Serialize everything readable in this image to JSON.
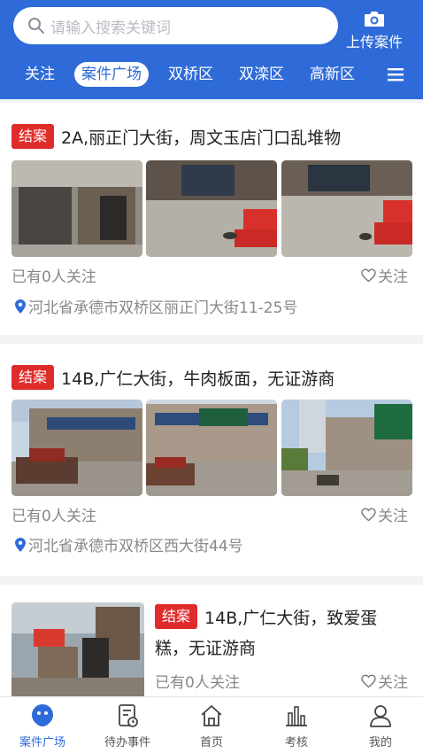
{
  "search": {
    "placeholder": "请输入搜索关键词"
  },
  "upload": {
    "label": "上传案件"
  },
  "tabs": [
    {
      "label": "关注"
    },
    {
      "label": "案件广场"
    },
    {
      "label": "双桥区"
    },
    {
      "label": "双滦区"
    },
    {
      "label": "高新区"
    }
  ],
  "cases": [
    {
      "status": "结案",
      "title": "2A,丽正门大街，周文玉店门口乱堆物",
      "follow_count": "已有0人关注",
      "follow_label": "关注",
      "address": "河北省承德市双桥区丽正门大街11-25号"
    },
    {
      "status": "结案",
      "title": "14B,广仁大街，牛肉板面，无证游商",
      "follow_count": "已有0人关注",
      "follow_label": "关注",
      "address": "河北省承德市双桥区西大街44号"
    },
    {
      "status": "结案",
      "title_line1": "14B,广仁大街，致爱蛋",
      "title_line2": "糕，无证游商",
      "follow_count": "已有0人关注",
      "follow_label": "关注"
    }
  ],
  "bottom_nav": [
    {
      "label": "案件广场"
    },
    {
      "label": "待办事件"
    },
    {
      "label": "首页"
    },
    {
      "label": "考核"
    },
    {
      "label": "我的"
    }
  ],
  "colors": {
    "primary": "#2f6bd8",
    "status_red": "#e02b2b"
  }
}
